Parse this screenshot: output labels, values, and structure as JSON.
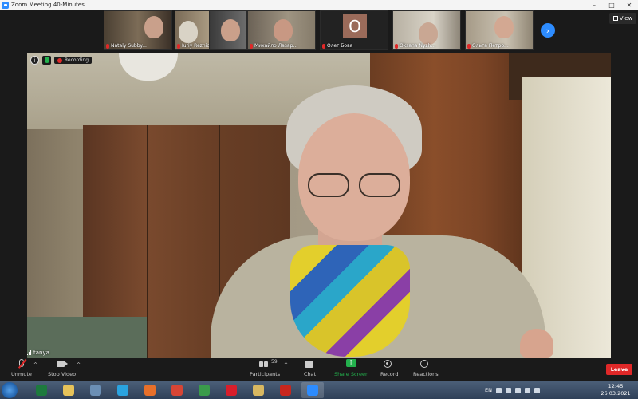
{
  "window": {
    "title": "Zoom Meeting 40-Minutes",
    "controls": [
      "–",
      "□",
      "✕"
    ]
  },
  "gallery": {
    "participants": [
      {
        "name": "Nataly Subby...",
        "muted": true
      },
      {
        "name": "Iuriy Reznichenko",
        "muted": true
      },
      {
        "name": "",
        "muted": false
      },
      {
        "name": "Михайло Лазар...",
        "muted": true
      },
      {
        "name": "Олег Бова",
        "muted": true,
        "avatar_letter": "O"
      },
      {
        "name": "Oksana Nyzh...",
        "muted": true
      },
      {
        "name": "Ольга Петро...",
        "muted": true
      }
    ],
    "next_icon": "chevron-right-icon",
    "view_label": "View"
  },
  "main_video": {
    "speaker": "tanya",
    "recording_label": "Recording"
  },
  "controls": {
    "unmute": "Unmute",
    "stop_video": "Stop Video",
    "participants": "Participants",
    "participant_count": "59",
    "chat": "Chat",
    "share_screen": "Share Screen",
    "record": "Record",
    "reactions": "Reactions",
    "leave": "Leave"
  },
  "taskbar": {
    "lang": "EN",
    "time": "12:45",
    "date": "26.03.2021",
    "apps": [
      {
        "icon": "excel-icon",
        "color": "#1d7a3e"
      },
      {
        "icon": "folder-icon",
        "color": "#e6c35a"
      },
      {
        "icon": "calculator-icon",
        "color": "#6b8fb5"
      },
      {
        "icon": "telegram-icon",
        "color": "#2aa3e0"
      },
      {
        "icon": "firefox-icon",
        "color": "#e8702a"
      },
      {
        "icon": "chrome-icon",
        "color": "#d64535"
      },
      {
        "icon": "chrome-icon",
        "color": "#3a9b4b"
      },
      {
        "icon": "opera-icon",
        "color": "#d81e2b"
      },
      {
        "icon": "files-icon",
        "color": "#d8b861"
      },
      {
        "icon": "pdf-icon",
        "color": "#c8261e"
      },
      {
        "icon": "zoom-icon",
        "color": "#2d8cff"
      }
    ]
  },
  "colors": {
    "accent": "#2d8cff",
    "leave": "#e02828",
    "share": "#23b14d"
  }
}
